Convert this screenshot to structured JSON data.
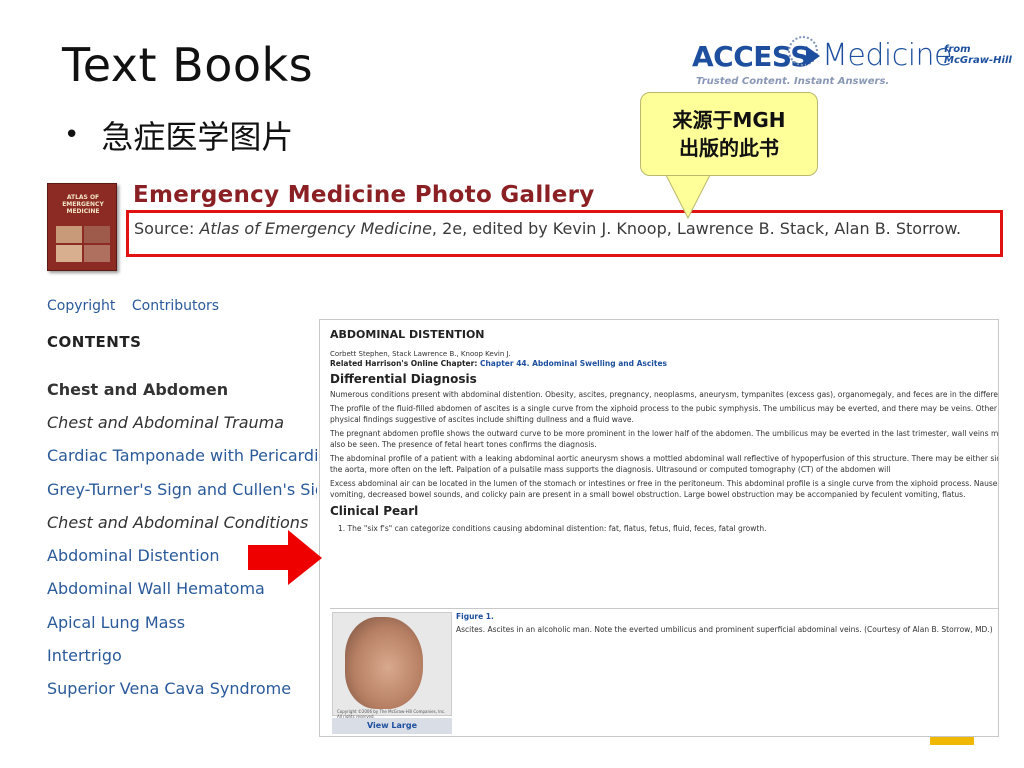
{
  "slide": {
    "title": "Text Books",
    "bullet": "急症医学图片"
  },
  "logo": {
    "brand_bold": "ACCESS",
    "brand_light": "Medicine",
    "from_line1": "from",
    "from_line2": "McGraw-Hill",
    "tagline": "Trusted Content. Instant Answers."
  },
  "callout": {
    "text": "来源于MGH\n出版的此书",
    "color": "#ffff99"
  },
  "book_cover": {
    "title": "ATLAS OF EMERGENCY MEDICINE"
  },
  "gallery": {
    "title": "Emergency Medicine Photo Gallery",
    "source_prefix": "Source: ",
    "source_book": "Atlas of Emergency Medicine",
    "source_suffix": ", 2e, edited by Kevin J. Knoop, Lawrence B. Stack, Alan B. Storrow.",
    "highlight_color": "#e01212"
  },
  "sidebar": {
    "links": [
      "Copyright",
      "Contributors"
    ],
    "contents_heading": "CONTENTS",
    "section_heading": "Chest and Abdomen",
    "items": [
      {
        "label": "Chest and Abdominal Trauma",
        "italic": true
      },
      {
        "label": "Cardiac Tamponade with Pericardial Effusion",
        "italic": false
      },
      {
        "label": "Grey-Turner's Sign and Cullen's Sign",
        "italic": false
      },
      {
        "label": "Chest and Abdominal Conditions",
        "italic": true
      },
      {
        "label": "Abdominal Distention",
        "italic": false
      },
      {
        "label": "Abdominal Wall Hematoma",
        "italic": false
      },
      {
        "label": "Apical Lung Mass",
        "italic": false
      },
      {
        "label": "Intertrigo",
        "italic": false
      },
      {
        "label": "Superior Vena Cava Syndrome",
        "italic": false
      }
    ]
  },
  "article": {
    "title": "ABDOMINAL DISTENTION",
    "authors": "Corbett Stephen, Stack Lawrence B., Knoop Kevin J.",
    "related_prefix": "Related Harrison's Online Chapter: ",
    "related_link": "Chapter 44. Abdominal Swelling and Ascites",
    "dd_heading": "Differential Diagnosis",
    "paragraphs": [
      "Numerous conditions present with abdominal distention. Obesity, ascites, pregnancy, neoplasms, aneurysm, tympanites (excess gas), organomegaly, and feces are in the differential.",
      "The profile of the fluid-filled abdomen of ascites is a single curve from the xiphoid process to the pubic symphysis. The umbilicus may be everted, and there may be veins. Other physical findings suggestive of ascites include shifting dullness and a fluid wave.",
      "The pregnant abdomen profile shows the outward curve to be more prominent in the lower half of the abdomen. The umbilicus may be everted in the last trimester, wall veins may also be seen. The presence of fetal heart tones confirms the diagnosis.",
      "The abdominal profile of a patient with a leaking abdominal aortic aneurysm shows a mottled abdominal wall reflective of hypoperfusion of this structure. There may be either side of the aorta, more often on the left. Palpation of a pulsatile mass supports the diagnosis. Ultrasound or computed tomography (CT) of the abdomen will",
      "Excess abdominal air can be located in the lumen of the stomach or intestines or free in the peritoneum. This abdominal profile is a single curve from the xiphoid process. Nausea, vomiting, decreased bowel sounds, and colicky pain are present in a small bowel obstruction. Large bowel obstruction may be accompanied by feculent vomiting, flatus."
    ],
    "pearl_heading": "Clinical Pearl",
    "pearl_item": "1.   The \"six f's\" can categorize conditions causing abdominal distention: fat, flatus, fetus, fluid, feces, fatal growth.",
    "figure_label": "Figure 1.",
    "figure_caption": "Ascites. Ascites in an alcoholic man. Note the everted umbilicus and prominent superficial abdominal veins. (Courtesy of Alan B. Storrow, MD.)",
    "figure_copyright": "Copyright ©2006 by The McGraw-Hill Companies, Inc. All rights reserved.",
    "view_large": "View Large"
  }
}
